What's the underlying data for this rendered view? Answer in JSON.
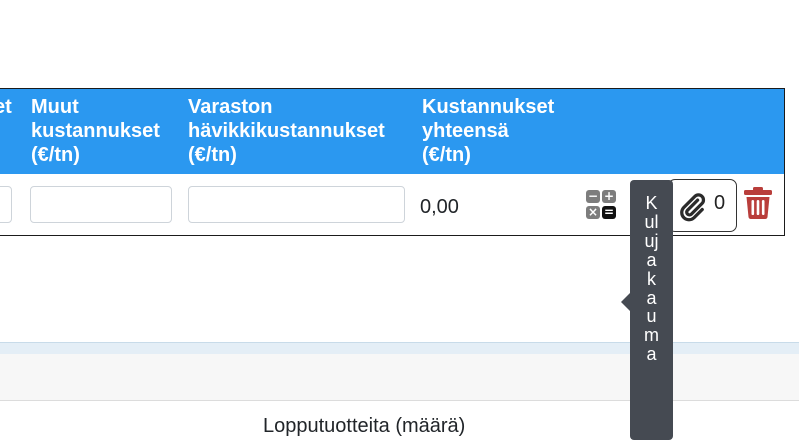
{
  "table": {
    "headers": [
      {
        "label": "et"
      },
      {
        "label": "Muut\nkustannukset\n(€/tn)"
      },
      {
        "label": "Varaston\nhävikkikustannukset\n(€/tn)"
      },
      {
        "label": "Kustannukset\nyhteensä\n(€/tn)"
      }
    ],
    "row": {
      "inputs": [
        {
          "value": "",
          "placeholder": ""
        },
        {
          "value": "",
          "placeholder": ""
        },
        {
          "value": "",
          "placeholder": ""
        }
      ],
      "total": "0,00",
      "calc_icon": "calculator-icon",
      "attachment_icon": "paperclip-icon",
      "attachment_count": "0",
      "delete_icon": "trash-icon"
    }
  },
  "tooltip": {
    "text": "Kulujakauma"
  },
  "panel": {
    "caption": "Lopputuotteita (määrä)"
  },
  "colors": {
    "header_bg": "#2b98f0",
    "tooltip_bg": "#454a52",
    "delete": "#b93e3b"
  }
}
